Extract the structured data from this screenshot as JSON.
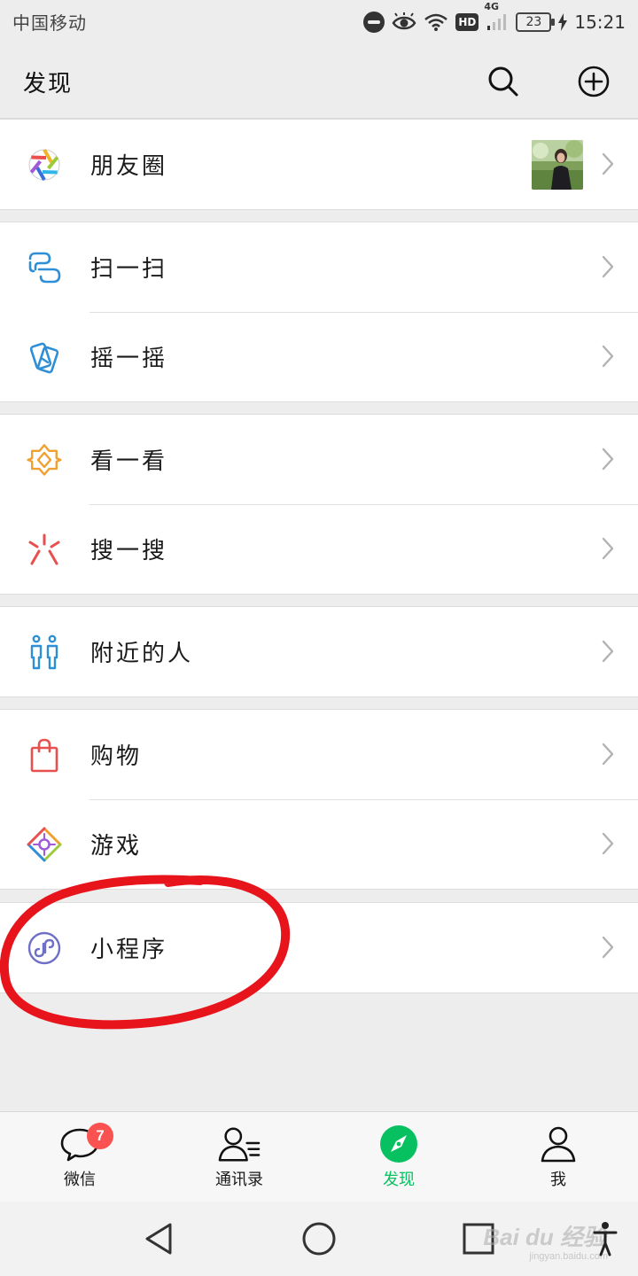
{
  "status_bar": {
    "carrier": "中国移动",
    "hd": "HD",
    "network": "4G",
    "battery": "23",
    "time": "15:21"
  },
  "header": {
    "title": "发现",
    "search_icon": "search-icon",
    "add_icon": "plus-circle-icon"
  },
  "groups": [
    {
      "items": [
        {
          "label": "朋友圈",
          "icon": "moments-aperture-icon",
          "has_thumbnail": true
        }
      ]
    },
    {
      "items": [
        {
          "label": "扫一扫",
          "icon": "scan-icon"
        },
        {
          "label": "摇一摇",
          "icon": "shake-icon"
        }
      ]
    },
    {
      "items": [
        {
          "label": "看一看",
          "icon": "top-stories-icon"
        },
        {
          "label": "搜一搜",
          "icon": "search-burst-icon"
        }
      ]
    },
    {
      "items": [
        {
          "label": "附近的人",
          "icon": "people-nearby-icon"
        }
      ]
    },
    {
      "items": [
        {
          "label": "购物",
          "icon": "shopping-bag-icon"
        },
        {
          "label": "游戏",
          "icon": "games-icon"
        }
      ]
    },
    {
      "items": [
        {
          "label": "小程序",
          "icon": "mini-program-icon"
        }
      ]
    }
  ],
  "tabs": [
    {
      "label": "微信",
      "icon": "chat-bubble-icon",
      "badge": "7",
      "active": false
    },
    {
      "label": "通讯录",
      "icon": "contacts-icon",
      "active": false
    },
    {
      "label": "发现",
      "icon": "compass-icon",
      "active": true
    },
    {
      "label": "我",
      "icon": "profile-icon",
      "active": false
    }
  ],
  "colors": {
    "accent": "#07c160",
    "badge": "#fa5151",
    "annotation": "#e8141b"
  },
  "watermark": {
    "text": "Bai du 经验",
    "sub": "jingyan.baidu.com"
  }
}
